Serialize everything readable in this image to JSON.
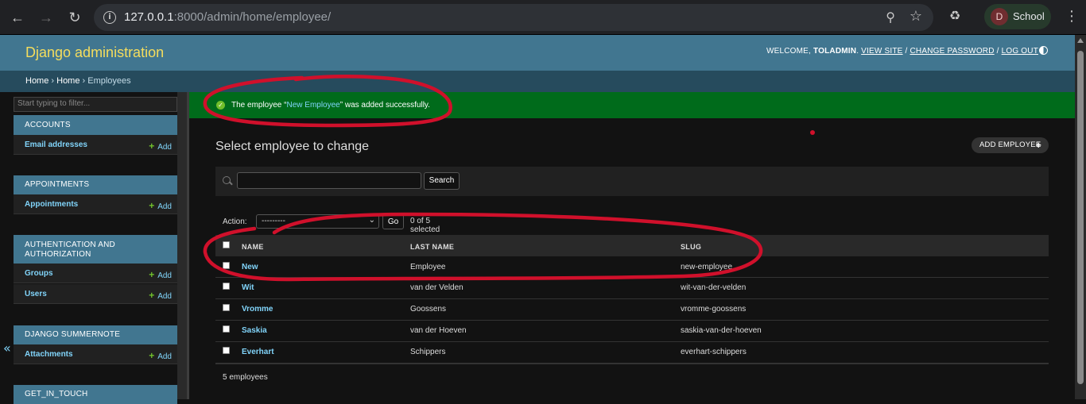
{
  "browser": {
    "url_host": "127.0.0.1",
    "url_path": ":8000/admin/home/employee/",
    "profile_initial": "D",
    "profile_name": "School"
  },
  "header": {
    "branding": "Django administration",
    "welcome": "WELCOME, ",
    "username": "TOLADMIN",
    "view_site": "VIEW SITE",
    "change_password": "CHANGE PASSWORD",
    "log_out": "LOG OUT"
  },
  "breadcrumbs": {
    "home": "Home",
    "app": "Home",
    "current": "Employees"
  },
  "sidebar": {
    "filter_placeholder": "Start typing to filter...",
    "modules": [
      {
        "caption": "ACCOUNTS",
        "models": [
          {
            "name": "Email addresses",
            "add": "Add"
          }
        ]
      },
      {
        "caption": "APPOINTMENTS",
        "models": [
          {
            "name": "Appointments",
            "add": "Add"
          }
        ]
      },
      {
        "caption": "AUTHENTICATION AND AUTHORIZATION",
        "models": [
          {
            "name": "Groups",
            "add": "Add"
          },
          {
            "name": "Users",
            "add": "Add"
          }
        ]
      },
      {
        "caption": "DJANGO SUMMERNOTE",
        "models": [
          {
            "name": "Attachments",
            "add": "Add"
          }
        ]
      },
      {
        "caption": "GET_IN_TOUCH",
        "models": []
      }
    ],
    "collapse_symbol": "«"
  },
  "message": {
    "prefix": "The employee “",
    "link": "New Employee",
    "suffix": "” was added successfully."
  },
  "content": {
    "title": "Select employee to change",
    "add_button": "ADD EMPLOYEE",
    "search_button": "Search",
    "action_label": "Action:",
    "action_selected": "---------",
    "go_button": "Go",
    "selected_count": "0 of 5 selected",
    "columns": [
      "NAME",
      "LAST NAME",
      "SLUG"
    ],
    "rows": [
      {
        "name": "New",
        "last_name": "Employee",
        "slug": "new-employee"
      },
      {
        "name": "Wit",
        "last_name": "van der Velden",
        "slug": "wit-van-der-velden"
      },
      {
        "name": "Vromme",
        "last_name": "Goossens",
        "slug": "vromme-goossens"
      },
      {
        "name": "Saskia",
        "last_name": "van der Hoeven",
        "slug": "saskia-van-der-hoeven"
      },
      {
        "name": "Everhart",
        "last_name": "Schippers",
        "slug": "everhart-schippers"
      }
    ],
    "result_count": "5 employees"
  },
  "colors": {
    "header_bg": "#417690",
    "branding": "#f5dd5d",
    "breadcrumbs_bg": "#264b5d",
    "success_bg": "#006b1b",
    "link": "#81d4fa",
    "annotation": "#d0102b"
  }
}
